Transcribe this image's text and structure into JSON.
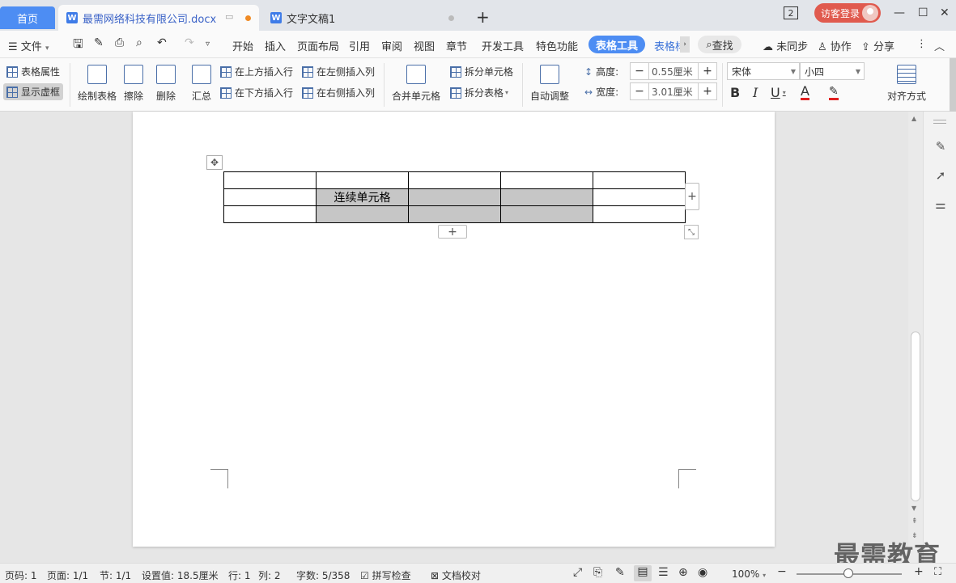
{
  "tabs": {
    "home": "首页",
    "doc1": "最需网络科技有限公司.docx",
    "doc2": "文字文稿1",
    "new_tab": "+"
  },
  "titlebar": {
    "page_badge": "2",
    "login": "访客登录",
    "minimize": "—",
    "maximize": "☐",
    "close": "✕"
  },
  "menu": {
    "file": "文件",
    "items": [
      "开始",
      "插入",
      "页面布局",
      "引用",
      "审阅",
      "视图",
      "章节",
      "开发工具",
      "特色功能"
    ],
    "active": "表格工具",
    "next": "表格样",
    "search": "查找",
    "sync": "未同步",
    "collab": "协作",
    "share": "分享"
  },
  "ribbon": {
    "table_props": "表格属性",
    "show_grid": "显示虚框",
    "draw_table": "绘制表格",
    "erase": "擦除",
    "delete": "删除",
    "summary": "汇总",
    "insert_above": "在上方插入行",
    "insert_below": "在下方插入行",
    "insert_left": "在左侧插入列",
    "insert_right": "在右侧插入列",
    "merge_cells": "合并单元格",
    "split_cells": "拆分单元格",
    "split_table": "拆分表格",
    "auto_adjust": "自动调整",
    "height_label": "高度:",
    "height_value": "0.55厘米",
    "width_label": "宽度:",
    "width_value": "3.01厘米",
    "font_name": "宋体",
    "font_size": "小四",
    "bold": "B",
    "italic": "I",
    "underline": "U",
    "font_color": "A",
    "align": "对齐方式"
  },
  "document": {
    "table": {
      "rows": [
        [
          "",
          "",
          "",
          "",
          ""
        ],
        [
          "",
          "连续单元格",
          "",
          "",
          ""
        ],
        [
          "",
          "",
          "",
          "",
          ""
        ]
      ]
    }
  },
  "status": {
    "page_no": "页码: 1",
    "page_count": "页面: 1/1",
    "section": "节: 1/1",
    "setting": "设置值: 18.5厘米",
    "row": "行: 1",
    "col": "列: 2",
    "word_count": "字数: 5/358",
    "spell_check": "拼写检查",
    "doc_check": "文档校对",
    "zoom": "100%"
  },
  "watermark": "最需教育",
  "colors": {
    "accent": "#4d8df3",
    "login": "#e05a4e",
    "selected_cell": "#c6c6c6"
  }
}
